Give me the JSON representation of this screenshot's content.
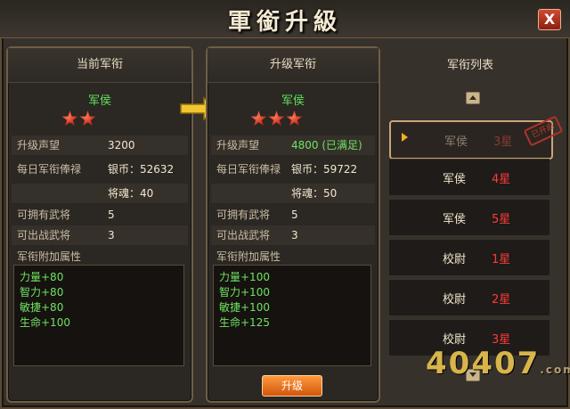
{
  "window": {
    "title": "軍銜升級",
    "close_label": "X"
  },
  "current": {
    "header": "当前军衔",
    "rank": "军侯",
    "stars": 2,
    "fields": [
      {
        "label": "升级声望",
        "value": "3200"
      },
      {
        "label": "每日军衔俸禄",
        "value": "银币：52632"
      },
      {
        "label": "",
        "value": "将魂：40"
      },
      {
        "label": "可拥有武将",
        "value": "5"
      },
      {
        "label": "可出战武将",
        "value": "3"
      }
    ],
    "attr_title": "军衔附加属性",
    "attrs": [
      "力量+80",
      "智力+80",
      "敏捷+80",
      "生命+100"
    ]
  },
  "next": {
    "header": "升级军衔",
    "rank": "军侯",
    "stars": 3,
    "fields": [
      {
        "label": "升级声望",
        "value": "4800 (已满足)"
      },
      {
        "label": "每日军衔俸禄",
        "value": "银币：59722"
      },
      {
        "label": "",
        "value": "将魂：50"
      },
      {
        "label": "可拥有武将",
        "value": "5"
      },
      {
        "label": "可出战武将",
        "value": "3"
      }
    ],
    "attr_title": "军衔附加属性",
    "attrs": [
      "力量+100",
      "智力+100",
      "敏捷+100",
      "生命+125"
    ]
  },
  "upgrade_button": "升级",
  "list": {
    "header": "军衔列表",
    "stamp": "已开启",
    "items": [
      {
        "name": "军侯",
        "star": "3星",
        "selected": true
      },
      {
        "name": "军侯",
        "star": "4星"
      },
      {
        "name": "军侯",
        "star": "5星"
      },
      {
        "name": "校尉",
        "star": "1星"
      },
      {
        "name": "校尉",
        "star": "2星"
      },
      {
        "name": "校尉",
        "star": "3星"
      }
    ]
  },
  "watermark": {
    "main": "40407",
    "suffix": ".com"
  },
  "colors": {
    "accent_green": "#6fe362",
    "star_red": "#ff3a3a",
    "button_orange": "#e8782a"
  }
}
